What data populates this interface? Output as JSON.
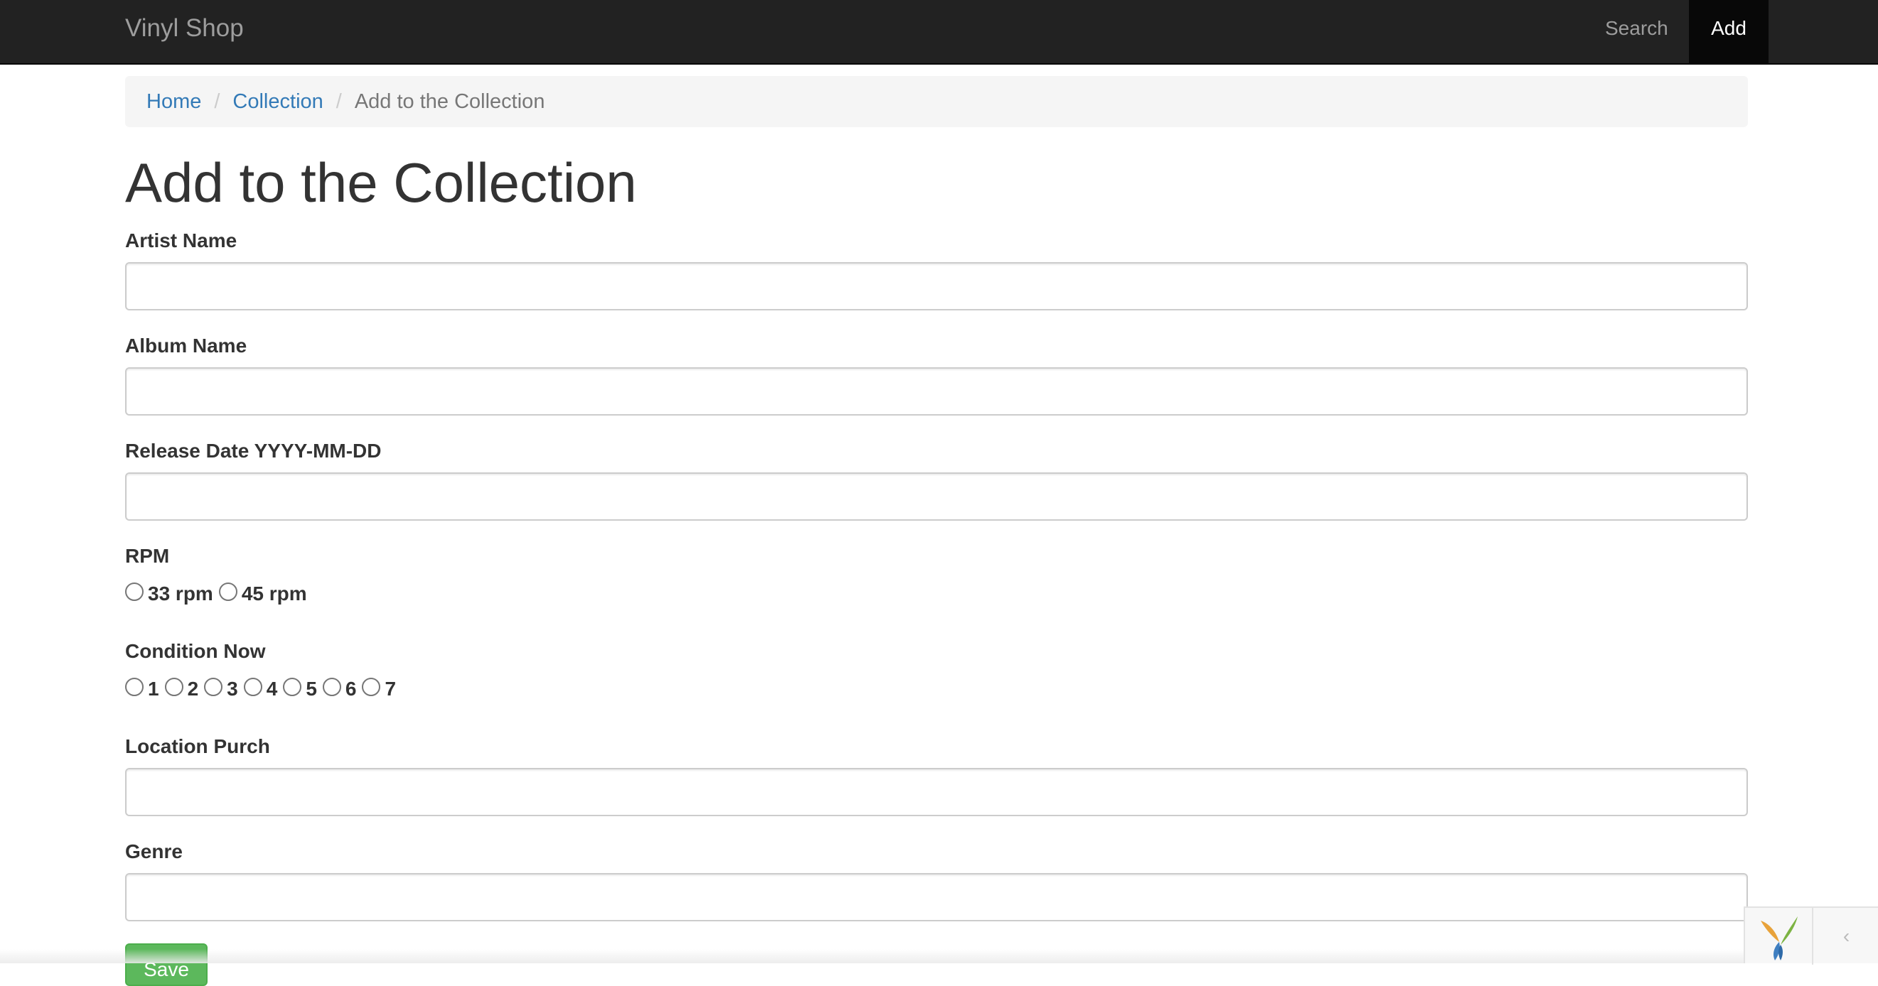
{
  "navbar": {
    "brand": "Vinyl Shop",
    "items": [
      {
        "label": "Search",
        "active": false
      },
      {
        "label": "Add",
        "active": true
      }
    ]
  },
  "breadcrumb": {
    "items": [
      {
        "label": "Home"
      },
      {
        "label": "Collection"
      }
    ],
    "active": "Add to the Collection",
    "separator": "/"
  },
  "page": {
    "title": "Add to the Collection"
  },
  "form": {
    "artist_name": {
      "label": "Artist Name",
      "value": ""
    },
    "album_name": {
      "label": "Album Name",
      "value": ""
    },
    "release_date": {
      "label": "Release Date YYYY-MM-DD",
      "value": ""
    },
    "rpm": {
      "label": "RPM",
      "options": [
        "33 rpm",
        "45 rpm"
      ]
    },
    "condition": {
      "label": "Condition Now",
      "options": [
        "1",
        "2",
        "3",
        "4",
        "5",
        "6",
        "7"
      ]
    },
    "location_purch": {
      "label": "Location Purch",
      "value": ""
    },
    "genre": {
      "label": "Genre",
      "value": ""
    },
    "submit_label": "Save"
  },
  "debug_toolbar": {
    "toggle_glyph": "‹"
  },
  "colors": {
    "navbar_bg": "#222222",
    "link": "#337ab7",
    "save_button": "#5cb85c"
  }
}
